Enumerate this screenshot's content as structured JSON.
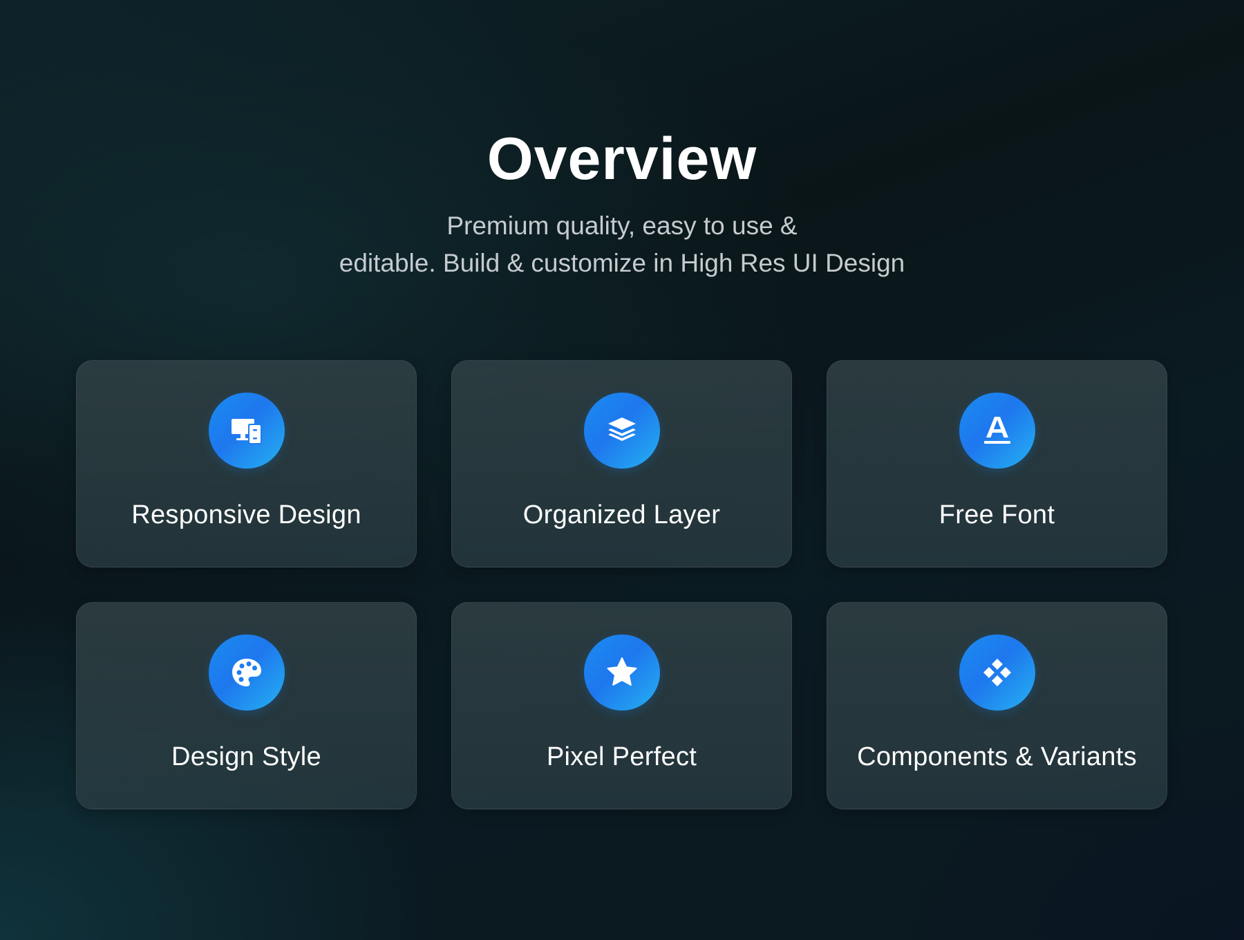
{
  "header": {
    "title": "Overview",
    "subtitle_line1": "Premium quality, easy to use &",
    "subtitle_line2": "editable. Build & customize in High Res UI Design"
  },
  "features": [
    {
      "label": "Responsive Design",
      "icon": "devices-icon"
    },
    {
      "label": "Organized Layer",
      "icon": "layers-icon"
    },
    {
      "label": "Free Font",
      "icon": "font-icon"
    },
    {
      "label": "Design Style",
      "icon": "palette-icon"
    },
    {
      "label": "Pixel Perfect",
      "icon": "star-icon"
    },
    {
      "label": "Components & Variants",
      "icon": "component-icon"
    }
  ],
  "colors": {
    "accent_start": "#1e77ee",
    "accent_end": "#25b1f2",
    "text_primary": "#ffffff",
    "text_secondary": "#c6cbcf"
  }
}
